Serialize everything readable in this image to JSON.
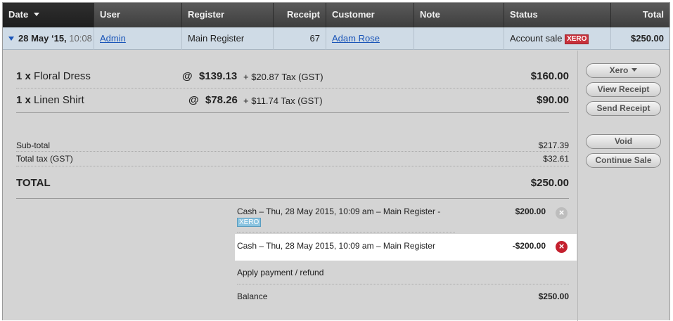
{
  "header": {
    "date": "Date",
    "user": "User",
    "register": "Register",
    "receipt": "Receipt",
    "customer": "Customer",
    "note": "Note",
    "status": "Status",
    "total": "Total"
  },
  "sale": {
    "date": "28 May ‘15,",
    "time": "10:08",
    "user": "Admin",
    "register": "Main Register",
    "receipt": "67",
    "customer": "Adam Rose",
    "note": "",
    "status": "Account sale",
    "status_badge": "XERO",
    "total": "$250.00"
  },
  "line_items": [
    {
      "qty": "1 x",
      "name": "Floral Dress",
      "at": "@",
      "price": "$139.13",
      "tax": "+ $20.87 Tax (GST)",
      "total": "$160.00"
    },
    {
      "qty": "1 x",
      "name": "Linen Shirt",
      "at": "@",
      "price": "$78.26",
      "tax": "+ $11.74 Tax (GST)",
      "total": "$90.00"
    }
  ],
  "totals": {
    "subtotal_label": "Sub-total",
    "subtotal": "$217.39",
    "tax_label": "Total tax (GST)",
    "tax": "$32.61",
    "total_label": "TOTAL",
    "total": "$250.00"
  },
  "payments": [
    {
      "text": "Cash – Thu, 28 May 2015, 10:09 am – Main Register -",
      "badge": "XERO",
      "amount": "$200.00",
      "icon": "remove-icon-grey"
    },
    {
      "text": "Cash – Thu, 28 May 2015, 10:09 am – Main Register",
      "amount": "-$200.00",
      "icon": "remove-icon-red"
    }
  ],
  "apply_payment": "Apply payment / refund",
  "balance_label": "Balance",
  "balance": "$250.00",
  "actions": {
    "xero": "Xero",
    "view_receipt": "View Receipt",
    "send_receipt": "Send Receipt",
    "void": "Void",
    "continue_sale": "Continue Sale"
  },
  "colors": {
    "header_bg": "#454545",
    "row_bg": "#cfdbe6",
    "panel_bg": "#d4d4d4",
    "xero_red": "#c8323c",
    "xero_blue": "#8cc4e0",
    "remove_red": "#c4202e"
  }
}
